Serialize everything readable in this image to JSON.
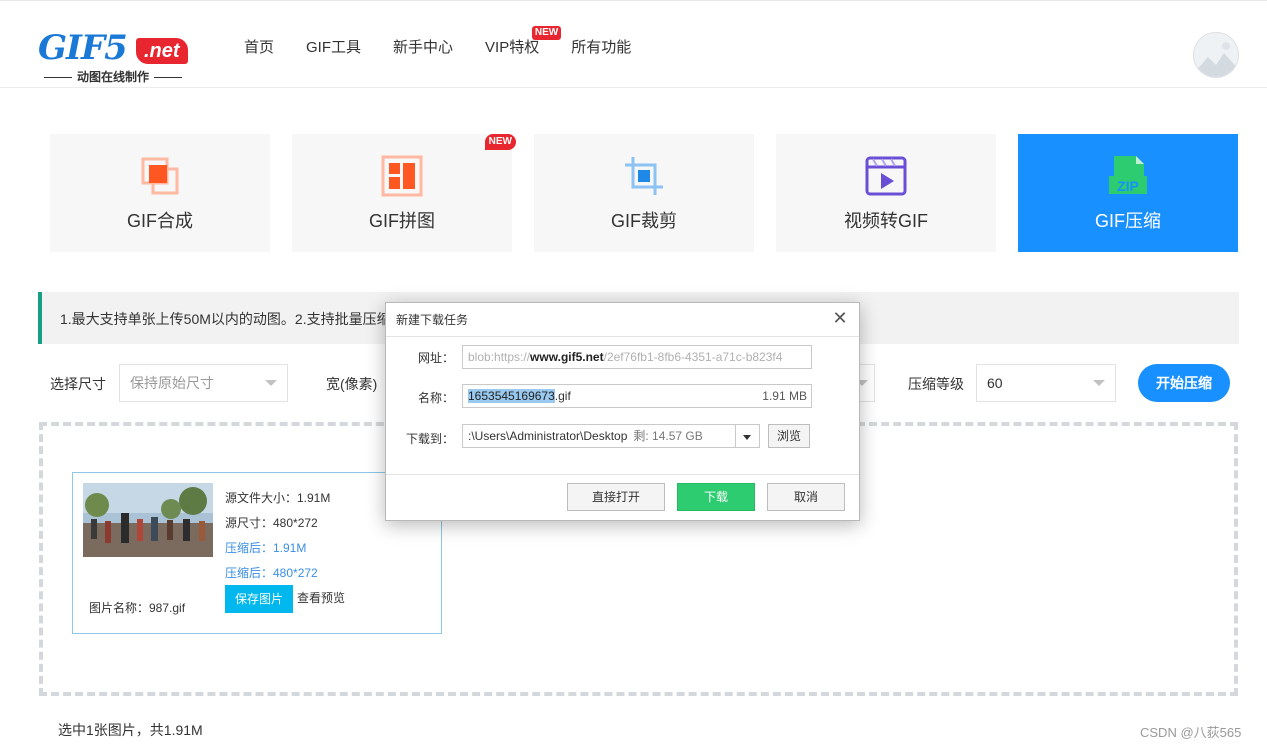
{
  "header": {
    "logo_main": "GIF5",
    "logo_net": ".net",
    "logo_sub": "动图在线制作",
    "nav": [
      "首页",
      "GIF工具",
      "新手中心",
      "VIP特权",
      "所有功能"
    ],
    "nav_badge": "NEW"
  },
  "tools": [
    {
      "label": "GIF合成",
      "icon": "merge-icon",
      "color": "#ff5722"
    },
    {
      "label": "GIF拼图",
      "icon": "collage-icon",
      "color": "#ff5722",
      "badge": "NEW"
    },
    {
      "label": "GIF裁剪",
      "icon": "crop-icon",
      "color": "#1e88e5"
    },
    {
      "label": "视频转GIF",
      "icon": "video-icon",
      "color": "#6a4fd6"
    },
    {
      "label": "GIF压缩",
      "icon": "zip-icon",
      "color": "#2ecc71",
      "active": true
    }
  ],
  "notice": "1.最大支持单张上传50M以内的动图。2.支持批量压缩",
  "options": {
    "size_label": "选择尺寸",
    "size_value": "保持原始尺寸",
    "width_label": "宽(像素)",
    "level_label": "压缩等级",
    "level_value": "60",
    "start_button": "开始压缩"
  },
  "file": {
    "orig_size": "源文件大小：1.91M",
    "orig_dim": "源尺寸：480*272",
    "new_size": "压缩后：1.91M",
    "new_dim": "压缩后：480*272",
    "name": "图片名称：987.gif",
    "save_button": "保存图片",
    "preview_link": "查看预览"
  },
  "summary": "选中1张图片，共1.91M",
  "watermark": "CSDN @八荻565",
  "dialog": {
    "title": "新建下载任务",
    "url_label": "网址：",
    "url_prefix": "blob:https://",
    "url_host": "www.gif5.net",
    "url_rest": "/2ef76fb1-8fb6-4351-a71c-b823f4",
    "name_label": "名称：",
    "name_selected": "1653545169673",
    "name_ext": ".gif",
    "name_size": "1.91 MB",
    "path_label": "下载到：",
    "path_value": ":\\Users\\Administrator\\Desktop",
    "path_free": "剩: 14.57 GB",
    "browse_button": "浏览",
    "open_button": "直接打开",
    "download_button": "下载",
    "cancel_button": "取消"
  }
}
